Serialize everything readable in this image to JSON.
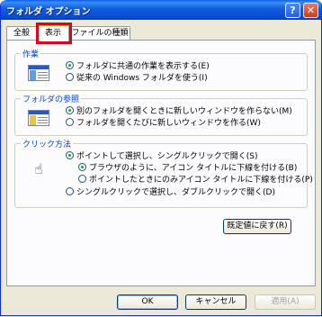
{
  "window": {
    "title": "フォルダ オプション"
  },
  "titlebar": {
    "help_glyph": "?",
    "close_glyph": "✕"
  },
  "tabs": [
    {
      "label": "全般"
    },
    {
      "label": "表示"
    },
    {
      "label": "ファイルの種類"
    }
  ],
  "groups": {
    "tasks": {
      "label": "作業",
      "options": [
        {
          "label": "フォルダに共通の作業を表示する(E)",
          "selected": true
        },
        {
          "label": "従来の Windows フォルダを使う(I)",
          "selected": false
        }
      ]
    },
    "browse": {
      "label": "フォルダの参照",
      "options": [
        {
          "label": "別のフォルダを開くときに新しいウィンドウを作らない(M)",
          "selected": true
        },
        {
          "label": "フォルダを開くたびに新しいウィンドウを作る(W)",
          "selected": false
        }
      ]
    },
    "click": {
      "label": "クリック方法",
      "options": [
        {
          "label": "ポイントして選択し、シングルクリックで開く(S)",
          "selected": true
        },
        {
          "label": "ブラウザのように、アイコン タイトルに下線を付ける(B)",
          "selected": true
        },
        {
          "label": "ポイントしたときにのみアイコン タイトルに下線を付ける(P)",
          "selected": false
        },
        {
          "label": "シングルクリックで選択し、ダブルクリックで開く(D)",
          "selected": false
        }
      ]
    }
  },
  "restore_defaults": "既定値に戻す(R)",
  "buttons": {
    "ok": "OK",
    "cancel": "キャンセル",
    "apply": "適用(A)"
  },
  "colors": {
    "accent": "#0046d5",
    "highlight": "#e0001a"
  }
}
